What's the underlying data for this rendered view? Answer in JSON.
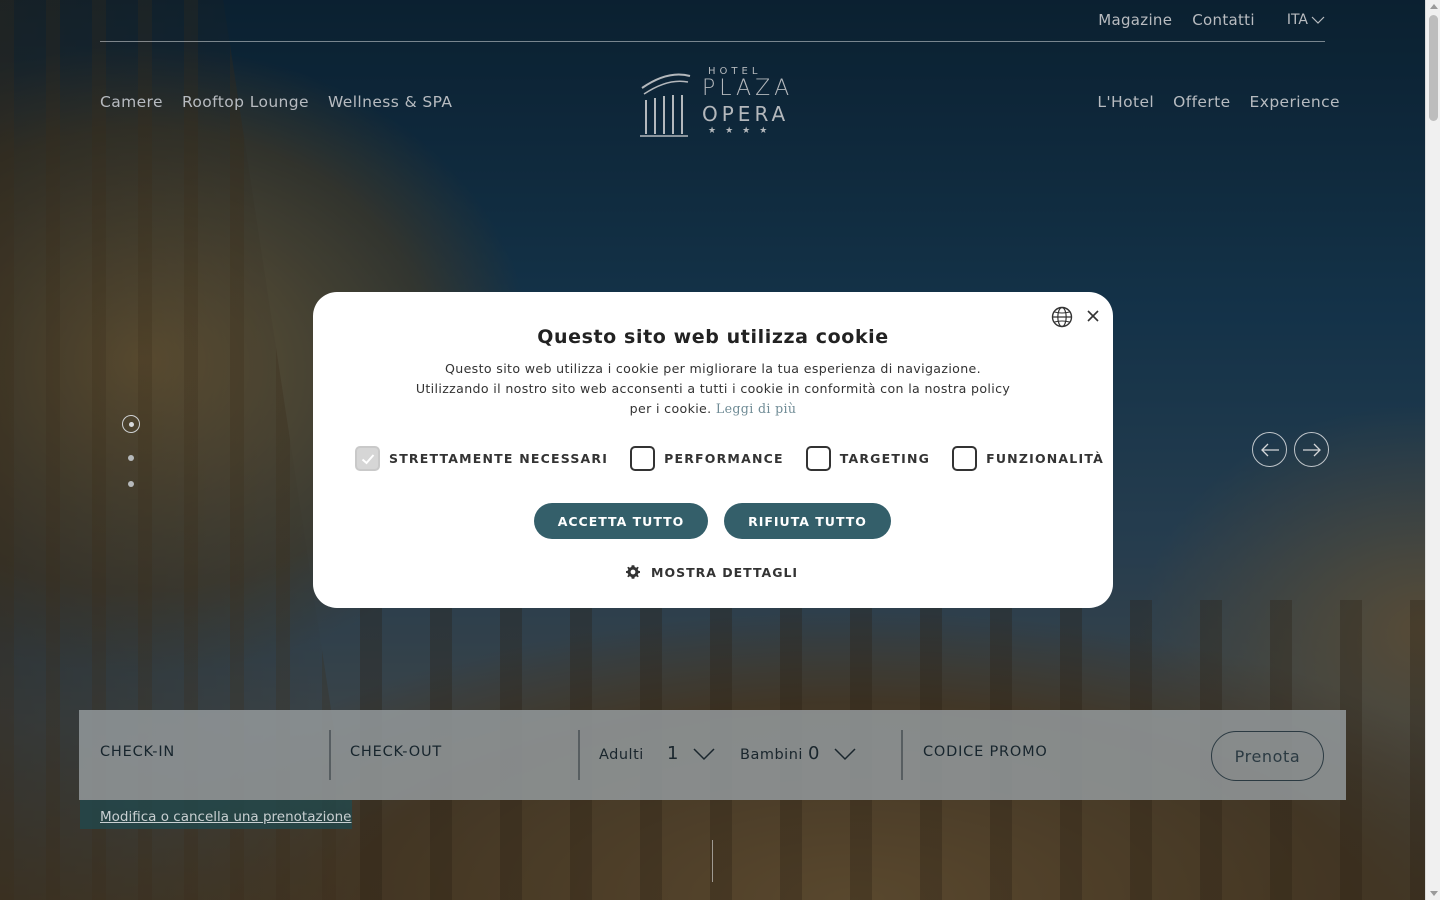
{
  "header": {
    "top_links": [
      "Magazine",
      "Contatti"
    ],
    "language": "ITA",
    "nav_left": [
      "Camere",
      "Rooftop Lounge",
      "Wellness & SPA"
    ],
    "nav_right": [
      "L'Hotel",
      "Offerte",
      "Experience"
    ],
    "logo": {
      "hotel": "HOTEL",
      "line1": "PLAZA",
      "line2": "OPERA",
      "stars": "★★★★"
    }
  },
  "slider": {
    "slide_count": 3,
    "active_slide": 1
  },
  "booking": {
    "checkin_label": "CHECK-IN",
    "checkout_label": "CHECK-OUT",
    "adults_label": "Adulti",
    "adults_value": "1",
    "children_label": "Bambini",
    "children_value": "0",
    "promo_label": "CODICE PROMO",
    "book_button": "Prenota",
    "modify_link": "Modifica o cancella una prenotazione"
  },
  "cookie_modal": {
    "title": "Questo sito web utilizza cookie",
    "body": "Questo sito web utilizza i cookie per migliorare la tua esperienza di navigazione. Utilizzando il nostro sito web acconsenti a tutti i cookie in conformità con la nostra policy per i cookie.",
    "read_more": "Leggi di più",
    "options": [
      {
        "label": "STRETTAMENTE NECESSARI",
        "checked": true
      },
      {
        "label": "PERFORMANCE",
        "checked": false
      },
      {
        "label": "TARGETING",
        "checked": false
      },
      {
        "label": "FUNZIONALITÀ",
        "checked": false
      }
    ],
    "accept_all": "ACCETTA TUTTO",
    "reject_all": "RIFIUTA TUTTO",
    "show_details": "MOSTRA DETTAGLI"
  },
  "colors": {
    "modal_button": "#345f6a",
    "booking_bar": "#919698",
    "modify_bg": "#1f4a4f"
  }
}
